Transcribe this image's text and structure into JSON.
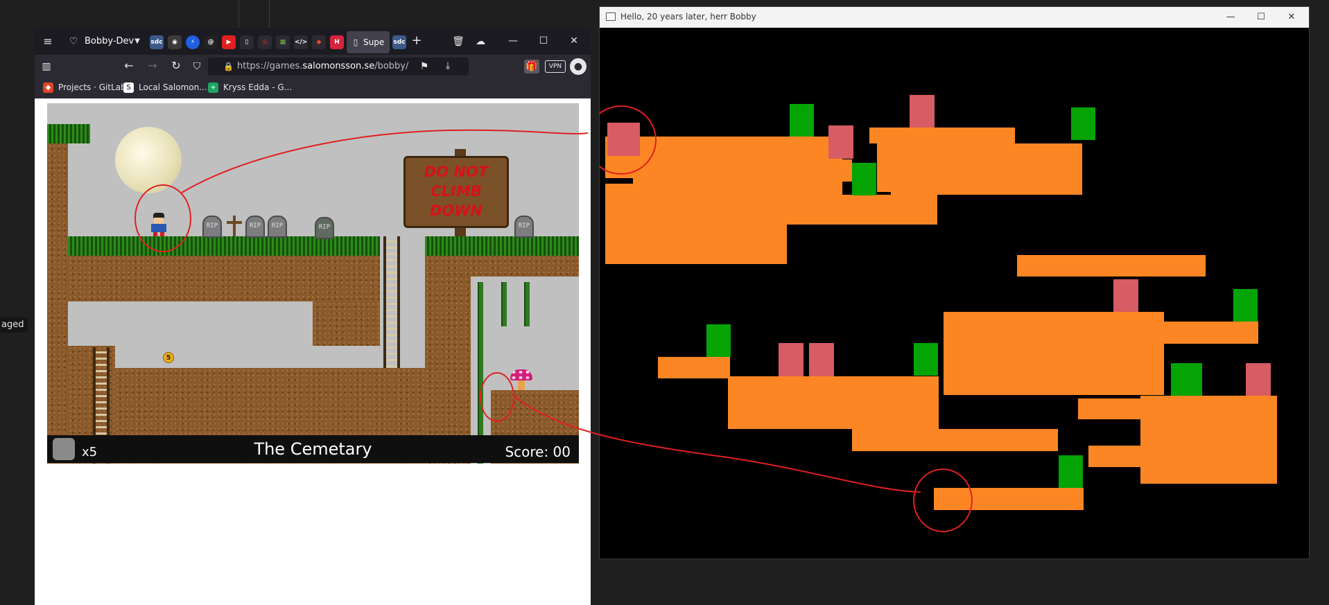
{
  "desktop": {
    "side_label": "aged"
  },
  "browser": {
    "profile_name": "Bobby-Dev",
    "tabs": [
      {
        "label": "Supe",
        "active": true
      }
    ],
    "tab_icons": [
      "sdc",
      "github",
      "messenger",
      "threads",
      "youtube",
      "doc",
      "opera",
      "gallery",
      "code",
      "git",
      "hub",
      "sdc2"
    ],
    "url": {
      "prefix": "https://games.",
      "domain": "salomonsson.se",
      "path": "/bobby/"
    },
    "vpn_label": "VPN",
    "bookmarks": [
      {
        "label": "Projects · GitLab",
        "color": "#e24329"
      },
      {
        "label": "Local Salomon...",
        "color": "#ffffff"
      },
      {
        "label": "Kryss Edda - G...",
        "color": "#1fa463"
      }
    ]
  },
  "game": {
    "sign_text": [
      "DO NOT",
      "CLIMB",
      "DOWN"
    ],
    "tombstone_text": "RIP",
    "coin_value": "5",
    "lives_text": "x5",
    "level_name": "The Cemetary",
    "score_text": "Score: 00"
  },
  "window": {
    "title": "Hello, 20 years later, herr Bobby",
    "minimize": "—",
    "maximize": "☐",
    "close": "✕"
  }
}
